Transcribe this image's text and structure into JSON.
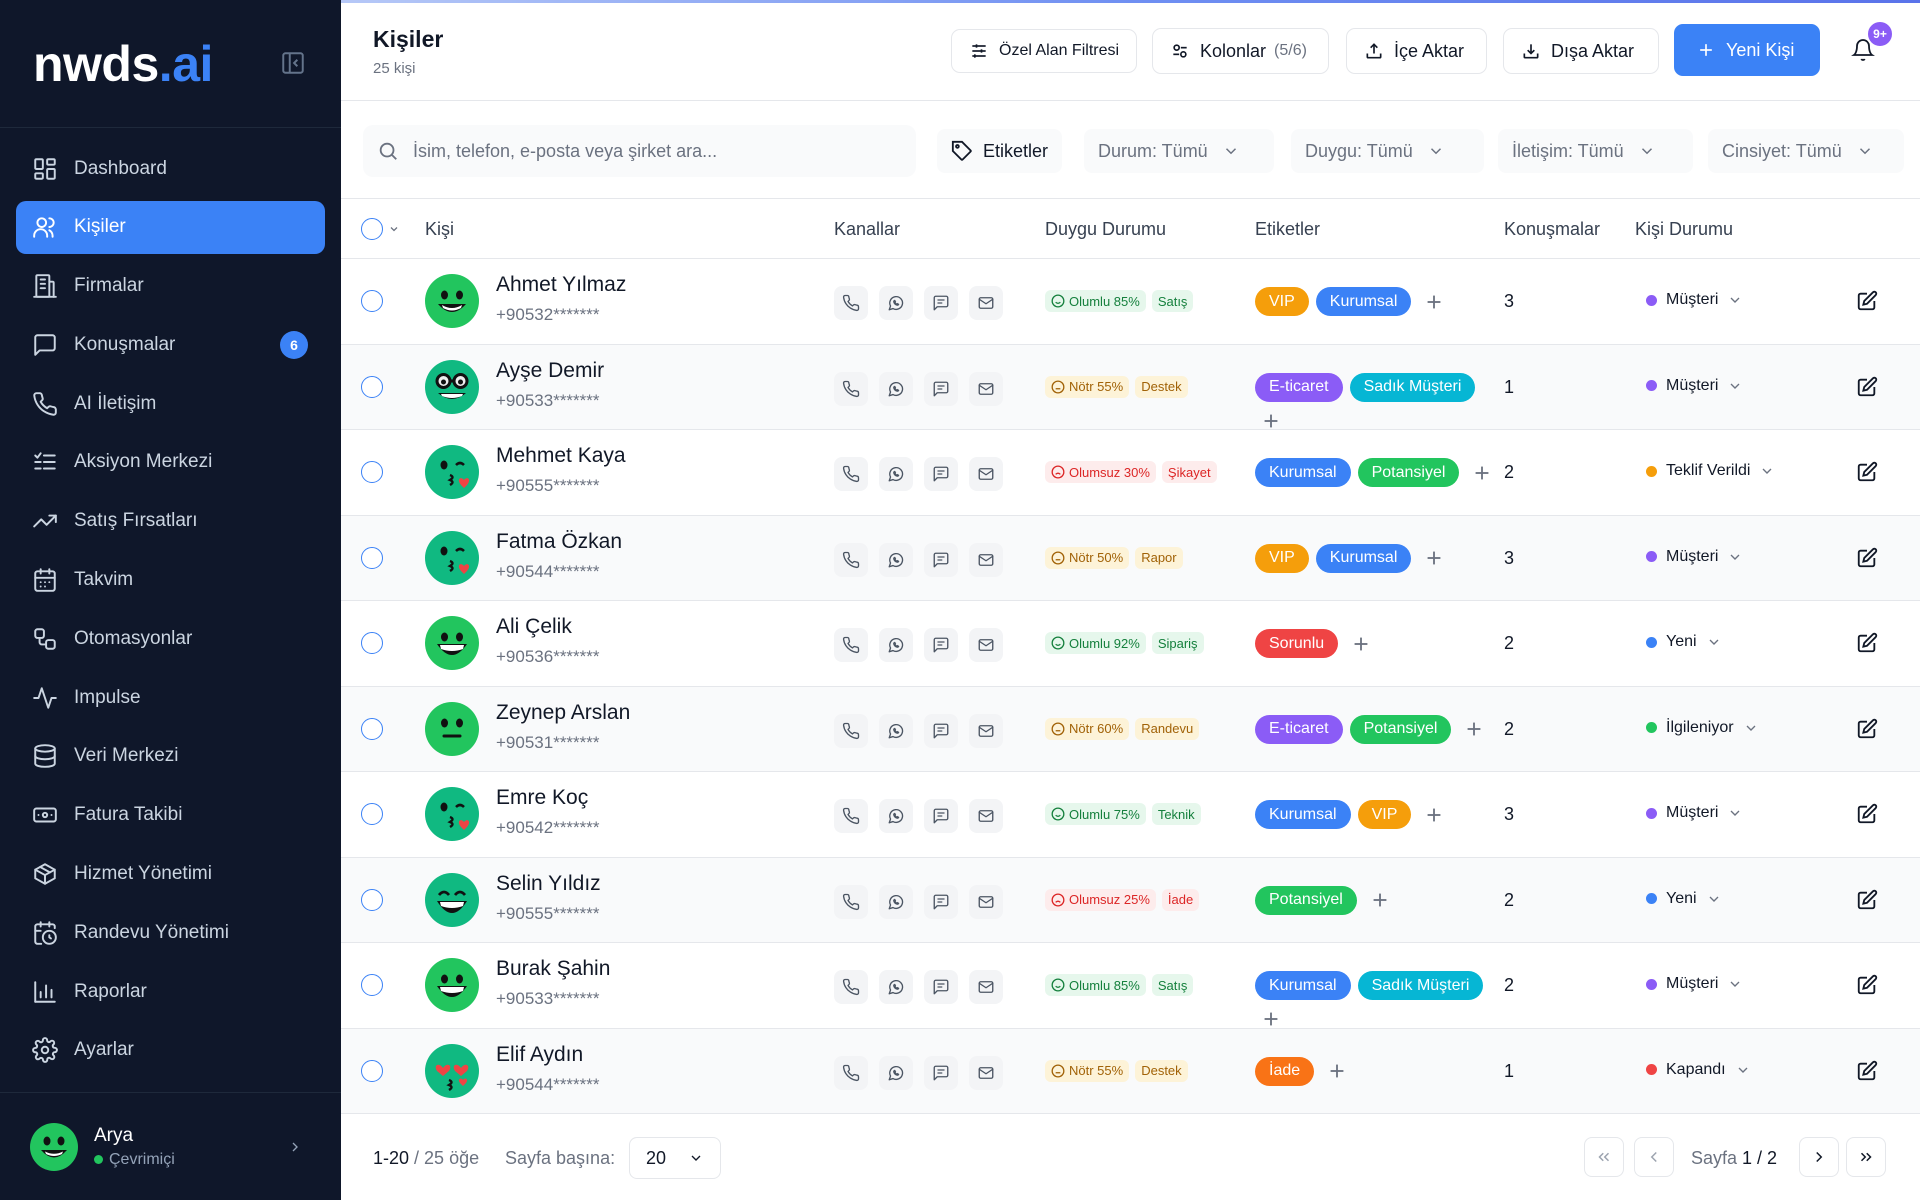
{
  "sidebar": {
    "logo_a": "nwds",
    "logo_b": ".ai",
    "items": [
      {
        "label": "Dashboard",
        "icon": "dashboard-icon"
      },
      {
        "label": "Kişiler",
        "icon": "users-icon",
        "active": true
      },
      {
        "label": "Firmalar",
        "icon": "building-icon"
      },
      {
        "label": "Konuşmalar",
        "icon": "chat-icon",
        "badge": "6"
      },
      {
        "label": "AI İletişim",
        "icon": "phone-icon"
      },
      {
        "label": "Aksiyon Merkezi",
        "icon": "list-check-icon"
      },
      {
        "label": "Satış Fırsatları",
        "icon": "trending-up-icon"
      },
      {
        "label": "Takvim",
        "icon": "calendar-icon"
      },
      {
        "label": "Otomasyonlar",
        "icon": "workflow-icon"
      },
      {
        "label": "Impulse",
        "icon": "pulse-icon"
      },
      {
        "label": "Veri Merkezi",
        "icon": "database-icon"
      },
      {
        "label": "Fatura Takibi",
        "icon": "banknote-icon"
      },
      {
        "label": "Hizmet Yönetimi",
        "icon": "package-icon"
      },
      {
        "label": "Randevu Yönetimi",
        "icon": "calendar-clock-icon"
      },
      {
        "label": "Raporlar",
        "icon": "bar-chart-icon"
      },
      {
        "label": "Ayarlar",
        "icon": "gear-icon"
      }
    ],
    "user": {
      "name": "Arya",
      "status": "Çevrimiçi"
    }
  },
  "header": {
    "title": "Kişiler",
    "subtitle": "25 kişi",
    "filter_btn": "Özel Alan Filtresi",
    "columns_btn": "Kolonlar",
    "columns_count": "(5/6)",
    "import_btn": "İçe Aktar",
    "export_btn": "Dışa Aktar",
    "new_btn": "Yeni Kişi",
    "notif_badge": "9+"
  },
  "filters": {
    "search_placeholder": "İsim, telefon, e-posta veya şirket ara...",
    "tags": "Etiketler",
    "status": "Durum: Tümü",
    "sentiment": "Duygu: Tümü",
    "contact": "İletişim: Tümü",
    "gender": "Cinsiyet: Tümü"
  },
  "table": {
    "headers": {
      "person": "Kişi",
      "channels": "Kanallar",
      "sentiment": "Duygu Durumu",
      "tags": "Etiketler",
      "convs": "Konuşmalar",
      "status": "Kişi Durumu"
    },
    "rows": [
      {
        "name": "Ahmet Yılmaz",
        "phone": "+90532*******",
        "avatar": "smile",
        "mood": "pos",
        "mood_label": "Olumlu 85%",
        "topic": "Satış",
        "tags": [
          {
            "t": "VIP",
            "c": "#f59e0b"
          },
          {
            "t": "Kurumsal",
            "c": "#3b82f6"
          }
        ],
        "conv": "3",
        "status": "Müşteri",
        "sc": "#8b5cf6"
      },
      {
        "name": "Ayşe Demir",
        "phone": "+90533*******",
        "avatar": "glasses",
        "mood": "neu",
        "mood_label": "Nötr 55%",
        "topic": "Destek",
        "tags": [
          {
            "t": "E-ticaret",
            "c": "#8b5cf6"
          },
          {
            "t": "Sadık Müşteri",
            "c": "#06b6d4"
          }
        ],
        "conv": "1",
        "status": "Müşteri",
        "sc": "#8b5cf6"
      },
      {
        "name": "Mehmet Kaya",
        "phone": "+90555*******",
        "avatar": "kiss",
        "mood": "neg",
        "mood_label": "Olumsuz 30%",
        "topic": "Şikayet",
        "tags": [
          {
            "t": "Kurumsal",
            "c": "#3b82f6"
          },
          {
            "t": "Potansiyel",
            "c": "#22c55e"
          }
        ],
        "conv": "2",
        "status": "Teklif Verildi",
        "sc": "#f59e0b"
      },
      {
        "name": "Fatma Özkan",
        "phone": "+90544*******",
        "avatar": "kiss",
        "mood": "neu",
        "mood_label": "Nötr 50%",
        "topic": "Rapor",
        "tags": [
          {
            "t": "VIP",
            "c": "#f59e0b"
          },
          {
            "t": "Kurumsal",
            "c": "#3b82f6"
          }
        ],
        "conv": "3",
        "status": "Müşteri",
        "sc": "#8b5cf6"
      },
      {
        "name": "Ali Çelik",
        "phone": "+90536*******",
        "avatar": "grin",
        "mood": "pos",
        "mood_label": "Olumlu 92%",
        "topic": "Sipariş",
        "tags": [
          {
            "t": "Sorunlu",
            "c": "#ef4444"
          }
        ],
        "conv": "2",
        "status": "Yeni",
        "sc": "#3b82f6"
      },
      {
        "name": "Zeynep Arslan",
        "phone": "+90531*******",
        "avatar": "neutral",
        "mood": "neu",
        "mood_label": "Nötr 60%",
        "topic": "Randevu",
        "tags": [
          {
            "t": "E-ticaret",
            "c": "#8b5cf6"
          },
          {
            "t": "Potansiyel",
            "c": "#22c55e"
          }
        ],
        "conv": "2",
        "status": "İlgileniyor",
        "sc": "#22c55e"
      },
      {
        "name": "Emre Koç",
        "phone": "+90542*******",
        "avatar": "kiss",
        "mood": "pos",
        "mood_label": "Olumlu 75%",
        "topic": "Teknik",
        "tags": [
          {
            "t": "Kurumsal",
            "c": "#3b82f6"
          },
          {
            "t": "VIP",
            "c": "#f59e0b"
          }
        ],
        "conv": "3",
        "status": "Müşteri",
        "sc": "#8b5cf6"
      },
      {
        "name": "Selin Yıldız",
        "phone": "+90555*******",
        "avatar": "laugh",
        "mood": "neg",
        "mood_label": "Olumsuz 25%",
        "topic": "İade",
        "tags": [
          {
            "t": "Potansiyel",
            "c": "#22c55e"
          }
        ],
        "conv": "2",
        "status": "Yeni",
        "sc": "#3b82f6"
      },
      {
        "name": "Burak Şahin",
        "phone": "+90533*******",
        "avatar": "grin",
        "mood": "pos",
        "mood_label": "Olumlu 85%",
        "topic": "Satış",
        "tags": [
          {
            "t": "Kurumsal",
            "c": "#3b82f6"
          },
          {
            "t": "Sadık Müşteri",
            "c": "#06b6d4"
          }
        ],
        "conv": "2",
        "status": "Müşteri",
        "sc": "#8b5cf6"
      },
      {
        "name": "Elif Aydın",
        "phone": "+90544*******",
        "avatar": "hearts",
        "mood": "neu",
        "mood_label": "Nötr 55%",
        "topic": "Destek",
        "tags": [
          {
            "t": "İade",
            "c": "#f97316"
          }
        ],
        "conv": "1",
        "status": "Kapandı",
        "sc": "#ef4444"
      }
    ]
  },
  "footer": {
    "range": "1-20",
    "total": "/ 25 öğe",
    "per_page_label": "Sayfa başına:",
    "per_page": "20",
    "page_label": "Sayfa",
    "page_value": "1 / 2"
  }
}
